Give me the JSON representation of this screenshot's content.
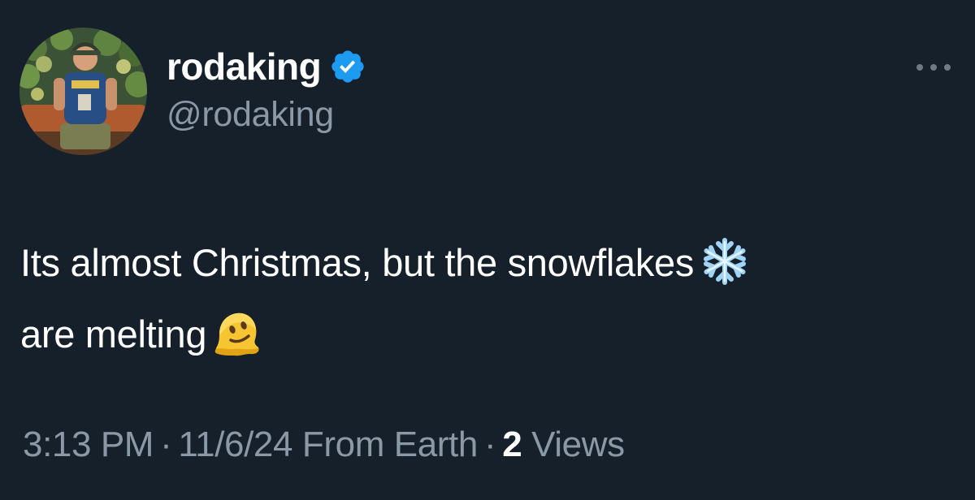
{
  "user": {
    "display_name": "rodaking",
    "handle": "@rodaking",
    "verified": true,
    "verified_icon": "verified-badge-icon"
  },
  "tweet": {
    "text_line1": "Its almost Christmas, but the snowflakes",
    "emoji1": "snowflake",
    "text_line2": "are melting",
    "emoji2": "melting-face"
  },
  "meta": {
    "time": "3:13 PM",
    "separator": "·",
    "date_location": "11/6/24 From Earth",
    "views_count": "2",
    "views_label": "Views"
  },
  "colors": {
    "background": "#15202b",
    "primary_text": "#ffffff",
    "secondary_text": "#8b98a5",
    "verified_blue": "#1d9bf0"
  }
}
